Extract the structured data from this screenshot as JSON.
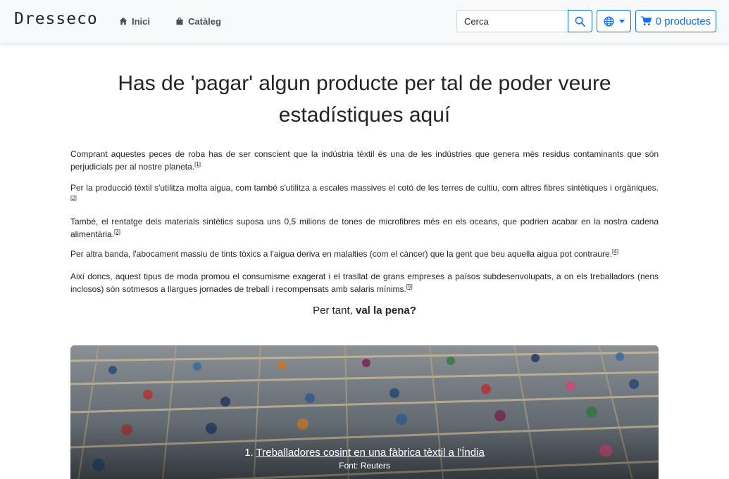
{
  "nav": {
    "brand": "Dresseco",
    "home_label": "Inici",
    "catalog_label": "Catàleg",
    "search_placeholder": "Cerca",
    "cart_label": "0 productes"
  },
  "main": {
    "headline": "Has de 'pagar' algun producte per tal de poder veure estadístiques aquí",
    "paragraphs": [
      {
        "text": "Comprant aquestes peces de roba has de ser conscient que la indústria tèxtil és una de les indústries que genera més residus contaminants que són perjudicials per al nostre planeta.",
        "ref": "[1]"
      },
      {
        "text": "Per la producció tèxtil s'utilitza molta aigua, com també s'utilitza a escales massives el cotó de les terres de cultiu, com altres fibres sintètiques i orgàniques.",
        "ref": "[2]"
      },
      {
        "text": "També, el rentatge dels materials sintètics suposa uns 0,5 milions de tones de microfibres més en els oceans, que podrien acabar en la nostra cadena alimentària.",
        "ref": "[3]"
      },
      {
        "text": "Per altra banda, l'abocament massiu de tints tòxics a l'aigua deriva en malalties (com el càncer) que la gent que beu aquella aigua pot contraure.",
        "ref": "[4]"
      },
      {
        "text": "Així doncs, aquest tipus de moda promou el consumisme exagerat i el trasllat de grans empreses a països subdesenvolupats, a on els treballadors (nens inclosos) són sotmesos a llargues jornades de treball i recompensats amb salaris mínims.",
        "ref": "[5]"
      }
    ],
    "conclusion_prefix": "Per tant, ",
    "conclusion_bold": "val la pena?"
  },
  "carousel": {
    "caption_number": "1. ",
    "caption_link": "Treballadores cosint en una fàbrica tèxtil a l'Índia",
    "caption_source": "Font: Reuters"
  },
  "colors": {
    "primary": "#0d6efd",
    "navbar_bg": "#f8f9fa",
    "text": "#212529"
  }
}
